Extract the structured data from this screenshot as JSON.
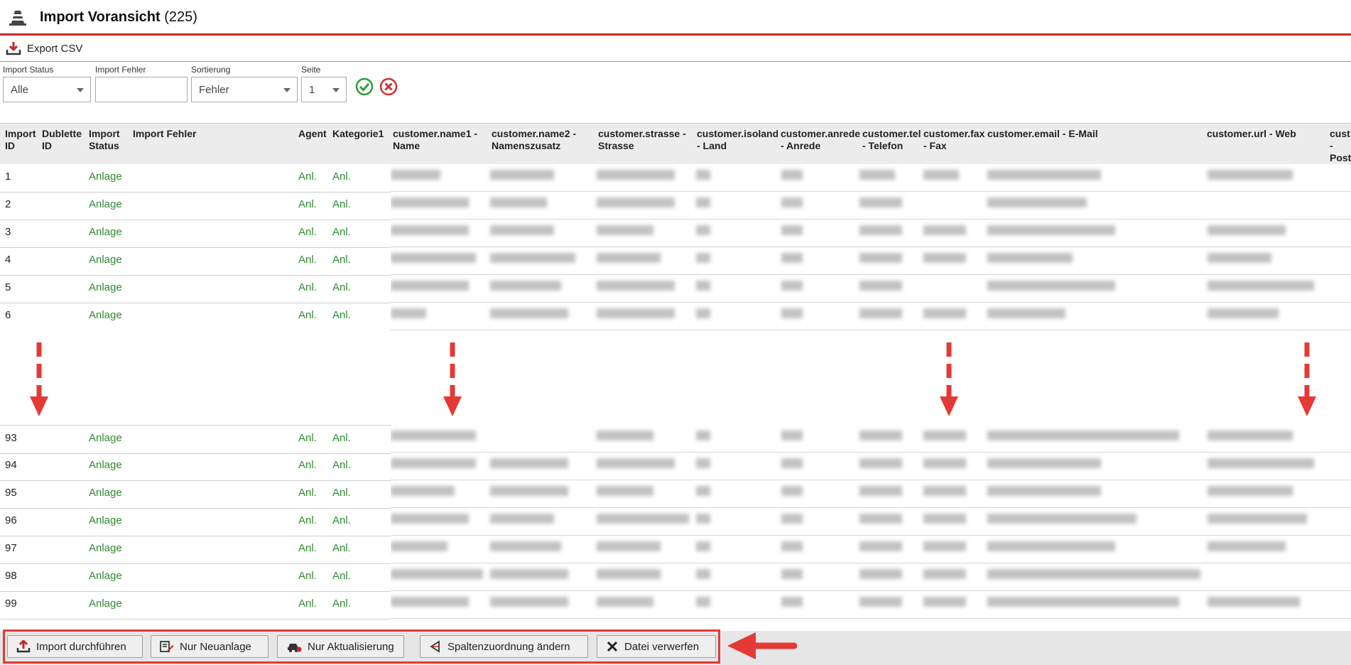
{
  "window": {
    "title": "Import Voransicht",
    "count": "(225)"
  },
  "toolbar": {
    "export_label": "Export CSV"
  },
  "filters": {
    "import_status": {
      "label": "Import Status",
      "value": "Alle"
    },
    "import_fehler": {
      "label": "Import Fehler",
      "value": ""
    },
    "sortierung": {
      "label": "Sortierung",
      "value": "Fehler"
    },
    "seite": {
      "label": "Seite",
      "value": "1"
    }
  },
  "table": {
    "headers": [
      "Import\nID",
      "Dublette\nID",
      "Import\nStatus",
      "Import Fehler",
      "Agent",
      "Kategorie1",
      "customer.name1 -\nName",
      "customer.name2 -\nNamenszusatz",
      "customer.strasse -\nStrasse",
      "customer.isoland\n- Land",
      "customer.anrede\n- Anrede",
      "customer.tel\n- Telefon",
      "customer.fax\n- Fax",
      "customer.email - E-Mail",
      "customer.url - Web",
      "cust\n-\nPost"
    ],
    "rows": [
      {
        "id": "1",
        "status": "Anlage",
        "agent": "Anl.",
        "kat": "Anl."
      },
      {
        "id": "2",
        "status": "Anlage",
        "agent": "Anl.",
        "kat": "Anl."
      },
      {
        "id": "3",
        "status": "Anlage",
        "agent": "Anl.",
        "kat": "Anl."
      },
      {
        "id": "4",
        "status": "Anlage",
        "agent": "Anl.",
        "kat": "Anl."
      },
      {
        "id": "5",
        "status": "Anlage",
        "agent": "Anl.",
        "kat": "Anl."
      },
      {
        "id": "6",
        "status": "Anlage",
        "agent": "Anl.",
        "kat": "Anl."
      },
      {
        "id": "93",
        "status": "Anlage",
        "agent": "Anl.",
        "kat": "Anl."
      },
      {
        "id": "94",
        "status": "Anlage",
        "agent": "Anl.",
        "kat": "Anl."
      },
      {
        "id": "95",
        "status": "Anlage",
        "agent": "Anl.",
        "kat": "Anl."
      },
      {
        "id": "96",
        "status": "Anlage",
        "agent": "Anl.",
        "kat": "Anl."
      },
      {
        "id": "97",
        "status": "Anlage",
        "agent": "Anl.",
        "kat": "Anl."
      },
      {
        "id": "98",
        "status": "Anlage",
        "agent": "Anl.",
        "kat": "Anl."
      },
      {
        "id": "99",
        "status": "Anlage",
        "agent": "Anl.",
        "kat": "Anl."
      }
    ]
  },
  "actions": {
    "import": "Import durchführen",
    "neuanlage": "Nur Neuanlage",
    "aktualisierung": "Nur Aktualisierung",
    "spalten": "Spaltenzuordnung ändern",
    "verwerfen": "Datei verwerfen"
  },
  "colors": {
    "accent": "#c8282a",
    "status_green": "#2e8b2e",
    "highlight": "#e53935"
  },
  "icons": [
    "traffic-cone-icon",
    "export-icon",
    "check-icon",
    "cancel-icon",
    "upload-icon",
    "edit-icon",
    "car-icon",
    "back-arrow-icon",
    "close-icon"
  ]
}
